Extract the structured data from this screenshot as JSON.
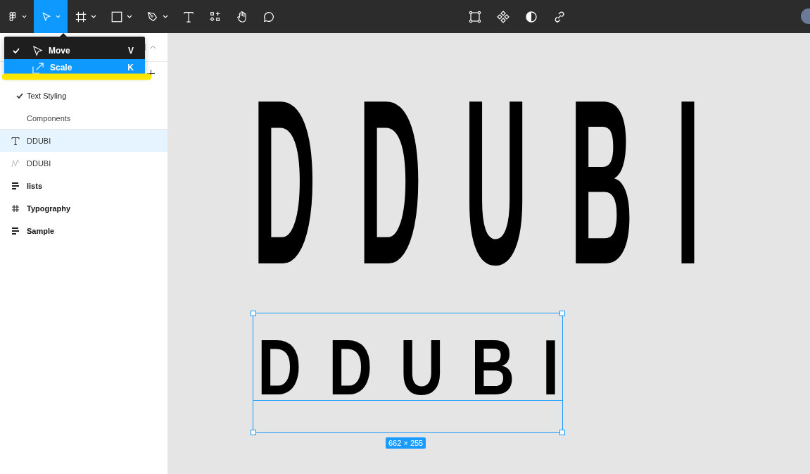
{
  "toolbar": {
    "tools": [
      {
        "kind": "logo",
        "selected": false,
        "caret": true
      },
      {
        "kind": "move",
        "selected": true,
        "caret": true
      },
      {
        "kind": "frame",
        "selected": false,
        "caret": true
      },
      {
        "kind": "shape",
        "selected": false,
        "caret": true
      },
      {
        "kind": "pen",
        "selected": false,
        "caret": true
      },
      {
        "kind": "text",
        "selected": false,
        "caret": false
      },
      {
        "kind": "resources",
        "selected": false,
        "caret": false
      },
      {
        "kind": "hand",
        "selected": false,
        "caret": false
      },
      {
        "kind": "comment",
        "selected": false,
        "caret": false
      }
    ],
    "center_tools": [
      {
        "kind": "frame-points"
      },
      {
        "kind": "component"
      },
      {
        "kind": "contrast"
      },
      {
        "kind": "link"
      }
    ]
  },
  "tool_menu": {
    "items": [
      {
        "kind": "move",
        "label": "Move",
        "shortcut": "V",
        "checked": true,
        "selected": false
      },
      {
        "kind": "scale",
        "label": "Scale",
        "shortcut": "K",
        "checked": false,
        "selected": true
      }
    ]
  },
  "pages": [
    {
      "label": "Text Styling",
      "checked": true
    },
    {
      "label": "Components",
      "checked": false
    }
  ],
  "layers": [
    {
      "kind": "text",
      "label": "DDUBI",
      "selected": true
    },
    {
      "kind": "path",
      "label": "DDUBI",
      "selected": false
    },
    {
      "kind": "list",
      "label": "lists",
      "selected": false
    },
    {
      "kind": "frame",
      "label": "Typography",
      "selected": false
    },
    {
      "kind": "list",
      "label": "Sample",
      "selected": false
    }
  ],
  "canvas": {
    "large_text": "DDUBI",
    "selected_text": "DDUBI",
    "size_label": "662 × 255"
  }
}
